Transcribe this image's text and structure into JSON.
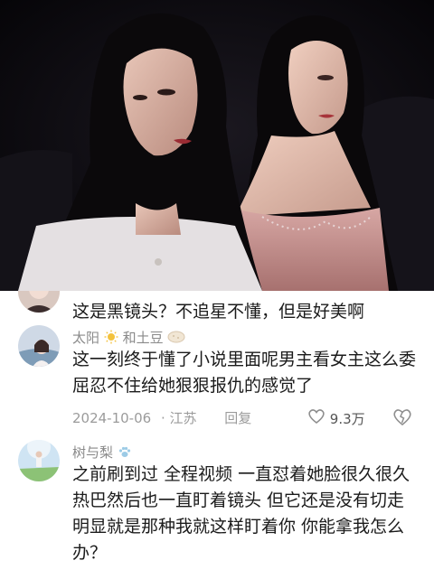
{
  "comments": [
    {
      "text": "这是黑镜头？不追星不懂，但是好美啊"
    },
    {
      "username": "太阳",
      "username_suffix": "和土豆",
      "text": "这一刻终于懂了小说里面呢男主看女主这么委屈忍不住给她狠狠报仇的感觉了",
      "date": "2024-10-06",
      "location": "· 江苏",
      "reply_label": "回复",
      "likes": "9.3万"
    },
    {
      "username": "树与梨",
      "text": "之前刷到过 全程视频 一直怼着她脸很久很久热巴然后也一直盯着镜头 但它还是没有切走明显就是那种我就这样盯着你 你能拿我怎么办？"
    }
  ],
  "icons": {
    "sun": "sun-icon",
    "potato": "potato-icon",
    "paw": "paw-icon",
    "like": "heart-icon",
    "dislike": "broken-heart-icon"
  },
  "colors": {
    "text": "#1b1b1b",
    "username": "#8a8a8a",
    "meta": "#9b9b9b"
  }
}
